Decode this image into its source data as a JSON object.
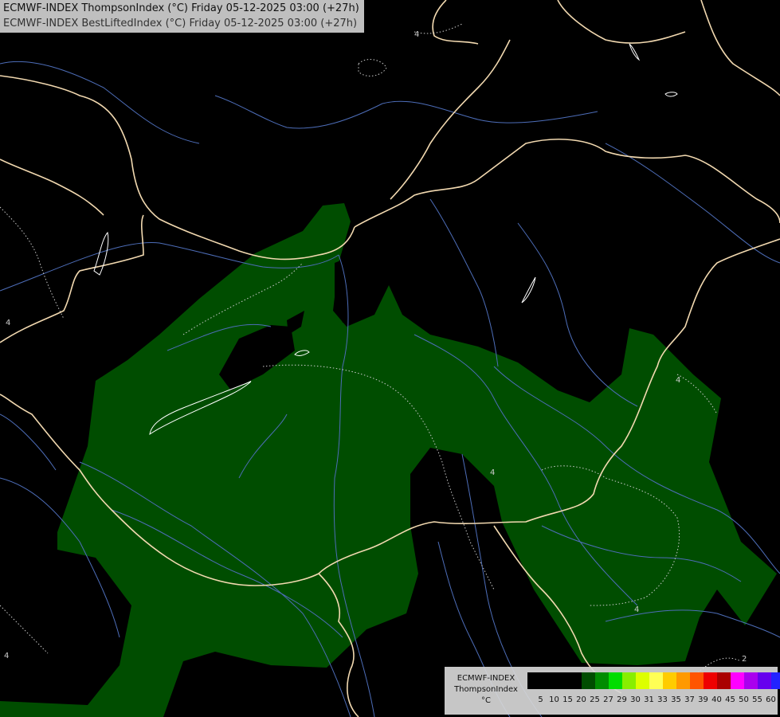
{
  "title": {
    "line1": "ECMWF-INDEX ThompsonIndex (°C) Friday 05-12-2025 03:00 (+27h)",
    "line2": "ECMWF-INDEX BestLiftedIndex (°C) Friday 05-12-2025 03:00 (+27h)"
  },
  "legend": {
    "label1": "ECMWF-INDEX",
    "label2": "ThompsonIndex",
    "label3": "°C",
    "ticks": [
      "5",
      "10",
      "15",
      "20",
      "25",
      "27",
      "29",
      "30",
      "31",
      "33",
      "35",
      "37",
      "39",
      "40",
      "45",
      "50",
      "55",
      "60"
    ],
    "colors": [
      "#000000",
      "#000000",
      "#000000",
      "#000000",
      "#004d00",
      "#008c00",
      "#00dd00",
      "#88ee00",
      "#ddff00",
      "#ffff55",
      "#ffcc00",
      "#ff9900",
      "#ff5500",
      "#ee0000",
      "#aa0000",
      "#ff00ff",
      "#aa00ee",
      "#6600ee",
      "#2222ff"
    ]
  },
  "contour_labels": [
    "4",
    "4",
    "4",
    "4",
    "4",
    "2",
    "4"
  ],
  "colors": {
    "background": "#000000",
    "fill_20_25": "#004d00",
    "borders": "#f2d9b0",
    "rivers": "#4d6db8",
    "contours": "#cccccc"
  }
}
